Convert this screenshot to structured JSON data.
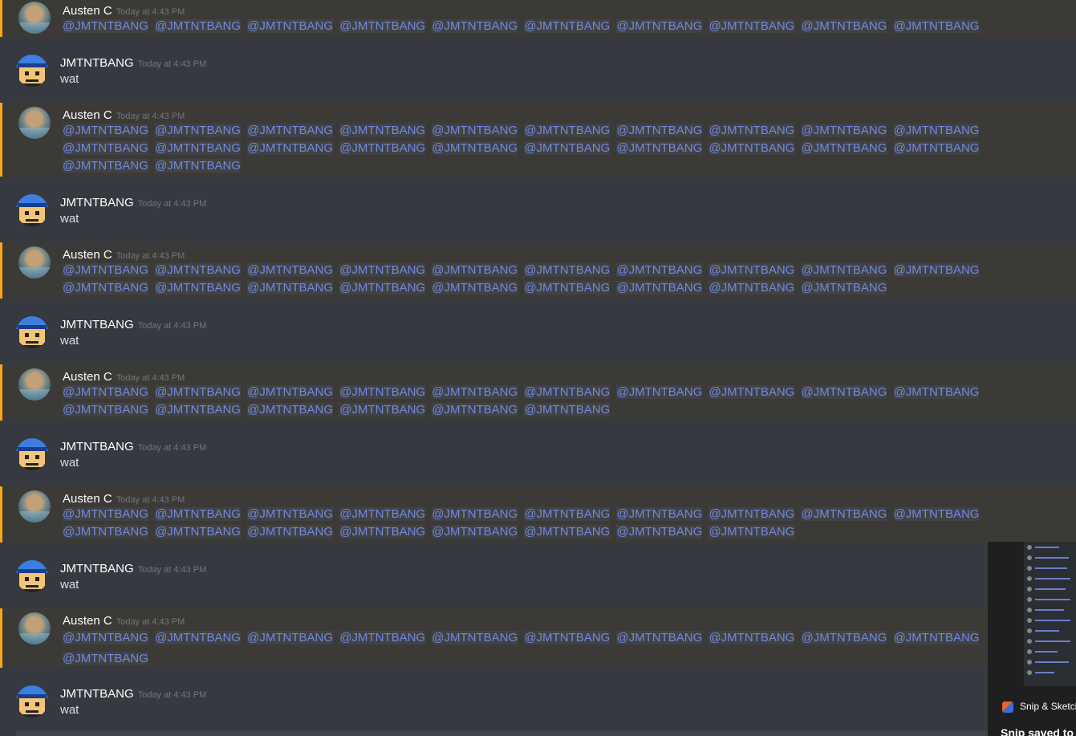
{
  "theme": {
    "accent": "#7289da",
    "mention_bar": "#faa61a",
    "background": "#36393f"
  },
  "messages": [
    {
      "author": "Austen C",
      "timestamp": "Today at 4:43 PM",
      "mentions": [
        "@JMTNTBANG",
        "@JMTNTBANG",
        "@JMTNTBANG",
        "@JMTNTBANG",
        "@JMTNTBANG",
        "@JMTNTBANG",
        "@JMTNTBANG",
        "@JMTNTBANG",
        "@JMTNTBANG",
        "@JMTNTBANG"
      ]
    },
    {
      "author": "JMTNTBANG",
      "timestamp": "Today at 4:43 PM",
      "text": "wat"
    },
    {
      "author": "Austen C",
      "timestamp": "Today at 4:43 PM",
      "mentions": [
        "@JMTNTBANG",
        "@JMTNTBANG",
        "@JMTNTBANG",
        "@JMTNTBANG",
        "@JMTNTBANG",
        "@JMTNTBANG",
        "@JMTNTBANG",
        "@JMTNTBANG",
        "@JMTNTBANG",
        "@JMTNTBANG",
        "@JMTNTBANG",
        "@JMTNTBANG",
        "@JMTNTBANG",
        "@JMTNTBANG",
        "@JMTNTBANG",
        "@JMTNTBANG",
        "@JMTNTBANG",
        "@JMTNTBANG",
        "@JMTNTBANG",
        "@JMTNTBANG",
        "@JMTNTBANG",
        "@JMTNTBANG"
      ]
    },
    {
      "author": "JMTNTBANG",
      "timestamp": "Today at 4:43 PM",
      "text": "wat"
    },
    {
      "author": "Austen C",
      "timestamp": "Today at 4:43 PM",
      "mentions": [
        "@JMTNTBANG",
        "@JMTNTBANG",
        "@JMTNTBANG",
        "@JMTNTBANG",
        "@JMTNTBANG",
        "@JMTNTBANG",
        "@JMTNTBANG",
        "@JMTNTBANG",
        "@JMTNTBANG",
        "@JMTNTBANG",
        "@JMTNTBANG",
        "@JMTNTBANG",
        "@JMTNTBANG",
        "@JMTNTBANG",
        "@JMTNTBANG",
        "@JMTNTBANG",
        "@JMTNTBANG",
        "@JMTNTBANG",
        "@JMTNTBANG"
      ]
    },
    {
      "author": "JMTNTBANG",
      "timestamp": "Today at 4:43 PM",
      "text": "wat"
    },
    {
      "author": "Austen C",
      "timestamp": "Today at 4:43 PM",
      "mentions": [
        "@JMTNTBANG",
        "@JMTNTBANG",
        "@JMTNTBANG",
        "@JMTNTBANG",
        "@JMTNTBANG",
        "@JMTNTBANG",
        "@JMTNTBANG",
        "@JMTNTBANG",
        "@JMTNTBANG",
        "@JMTNTBANG",
        "@JMTNTBANG",
        "@JMTNTBANG",
        "@JMTNTBANG",
        "@JMTNTBANG",
        "@JMTNTBANG",
        "@JMTNTBANG"
      ]
    },
    {
      "author": "JMTNTBANG",
      "timestamp": "Today at 4:43 PM",
      "text": "wat"
    },
    {
      "author": "Austen C",
      "timestamp": "Today at 4:43 PM",
      "mentions": [
        "@JMTNTBANG",
        "@JMTNTBANG",
        "@JMTNTBANG",
        "@JMTNTBANG",
        "@JMTNTBANG",
        "@JMTNTBANG",
        "@JMTNTBANG",
        "@JMTNTBANG",
        "@JMTNTBANG",
        "@JMTNTBANG",
        "@JMTNTBANG",
        "@JMTNTBANG",
        "@JMTNTBANG",
        "@JMTNTBANG",
        "@JMTNTBANG",
        "@JMTNTBANG",
        "@JMTNTBANG",
        "@JMTNTBANG"
      ]
    },
    {
      "author": "JMTNTBANG",
      "timestamp": "Today at 4:43 PM",
      "text": "wat"
    },
    {
      "author": "Austen C",
      "timestamp": "Today at 4:43 PM",
      "mentions": [
        "@JMTNTBANG",
        "@JMTNTBANG",
        "@JMTNTBANG",
        "@JMTNTBANG",
        "@JMTNTBANG",
        "@JMTNTBANG",
        "@JMTNTBANG",
        "@JMTNTBANG",
        "@JMTNTBANG",
        "@JMTNTBANG",
        "@JMTNTBANG"
      ]
    },
    {
      "author": "JMTNTBANG",
      "timestamp": "Today at 4:43 PM",
      "text": "wat"
    }
  ],
  "snip_notification": {
    "app_name": "Snip & Sketch",
    "message": "Snip saved to"
  }
}
